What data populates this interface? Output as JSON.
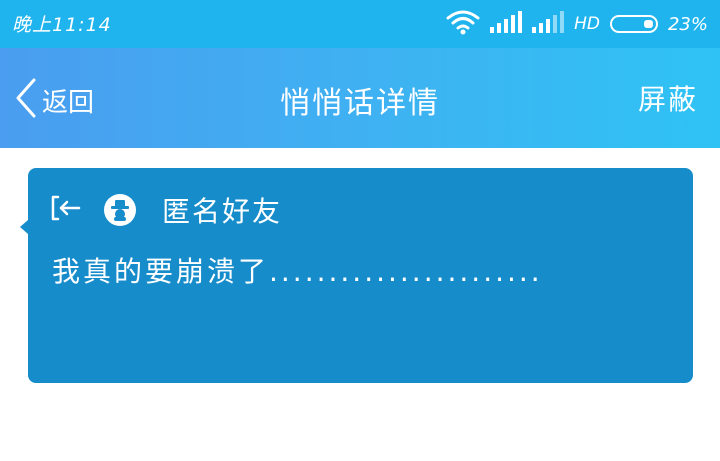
{
  "status_bar": {
    "time": "晚上11:14",
    "network_label": "HD",
    "battery_percent": "23%",
    "battery_level": 0.23,
    "icons": [
      "wifi-icon",
      "signal-icon",
      "signal-icon-2",
      "battery-icon"
    ]
  },
  "header": {
    "back_label": "返回",
    "title": "悄悄话详情",
    "block_label": "屏蔽",
    "gradient": [
      "#4a9df0",
      "#2fc3f4"
    ]
  },
  "message": {
    "sender": "匿名好友",
    "text": "我真的要崩溃了.......................",
    "card_color": "#168ccb",
    "icons": [
      "exit-icon",
      "anonymous-avatar-icon"
    ]
  },
  "colors": {
    "status_bar": "#1fb4ee",
    "text": "#ffffff",
    "page_background": "#ffffff"
  }
}
